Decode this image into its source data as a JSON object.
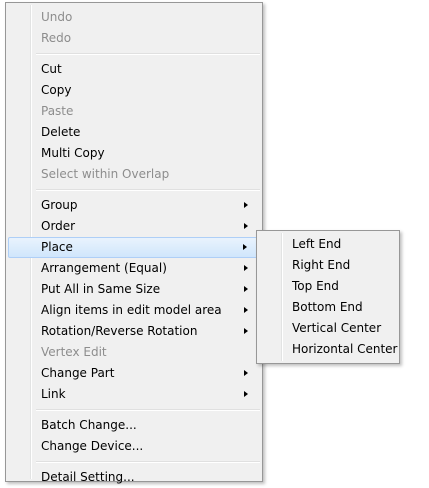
{
  "main_menu": {
    "undo": "Undo",
    "redo": "Redo",
    "cut": "Cut",
    "copy": "Copy",
    "paste": "Paste",
    "delete": "Delete",
    "multi_copy": "Multi Copy",
    "select_within_overlap": "Select within Overlap",
    "group": "Group",
    "order": "Order",
    "place": "Place",
    "arrangement_equal": "Arrangement (Equal)",
    "put_all_same_size": "Put All in Same Size",
    "align_items": "Align items in edit model area",
    "rotation": "Rotation/Reverse Rotation",
    "vertex_edit": "Vertex Edit",
    "change_part": "Change Part",
    "link": "Link",
    "batch_change": "Batch Change...",
    "change_device": "Change Device...",
    "detail_setting": "Detail Setting..."
  },
  "place_submenu": {
    "left_end": "Left End",
    "right_end": "Right End",
    "top_end": "Top End",
    "bottom_end": "Bottom End",
    "vertical_center": "Vertical Center",
    "horizontal_center": "Horizontal Center"
  },
  "icons": {
    "submenu_arrow": "chevron-right-icon"
  },
  "colors": {
    "menu_background": "#f0f0f0",
    "disabled_text": "#8d8d8d",
    "highlight": "#d0e6fc",
    "highlight_border": "#aecff7"
  }
}
